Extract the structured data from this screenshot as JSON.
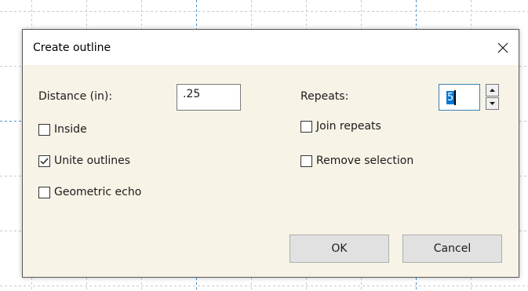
{
  "dialog": {
    "title": "Create outline",
    "close_icon": "close-icon"
  },
  "distance": {
    "label": "Distance (in):",
    "value": ".25"
  },
  "repeats": {
    "label": "Repeats:",
    "value": "5"
  },
  "options": {
    "inside": {
      "label": "Inside",
      "checked": false
    },
    "unite_outlines": {
      "label": "Unite outlines",
      "checked": true
    },
    "geometric_echo": {
      "label": "Geometric echo",
      "checked": false
    },
    "join_repeats": {
      "label": "Join repeats",
      "checked": false
    },
    "remove_selection": {
      "label": "Remove selection",
      "checked": false
    }
  },
  "buttons": {
    "ok": "OK",
    "cancel": "Cancel"
  },
  "colors": {
    "dialog_bg": "#f7f3e6",
    "selection": "#0078d7",
    "focus_border": "#3c7fb1"
  }
}
